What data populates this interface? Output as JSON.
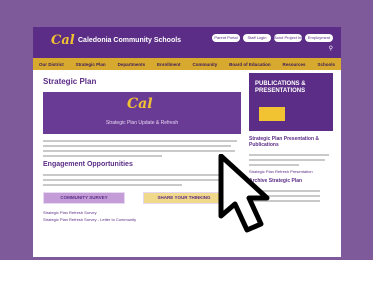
{
  "header": {
    "logo": "Cal",
    "school_name": "Caledonia Community Schools",
    "buttons": [
      "Parent Portal",
      "Staff Login",
      "Bond Project Info",
      "Employment"
    ]
  },
  "nav": {
    "items": [
      "Our District",
      "Strategic Plan",
      "Departments",
      "Enrollment",
      "Community",
      "Board of Education",
      "Resources",
      "Schools"
    ]
  },
  "main": {
    "title": "Strategic Plan",
    "banner_logo": "Cal",
    "banner_subtitle": "Strategic Plan Update & Refresh",
    "engagement_heading": "Engagement Opportunities",
    "survey_button": "COMMUNITY SURVEY",
    "thoughtexchange_button": "SHARE YOUR THINKING",
    "links": [
      "Strategic Plan Refresh Survey",
      "Strategic Plan Refresh Survey - Letter to Community"
    ]
  },
  "side": {
    "promo_title": "PUBLICATIONS & PRESENTATIONS",
    "caption": "Strategic Plan Presentation & Publications",
    "link": "Strategic Plan Refresh Presentation",
    "sub_heading": "Archive Strategic Plan"
  }
}
